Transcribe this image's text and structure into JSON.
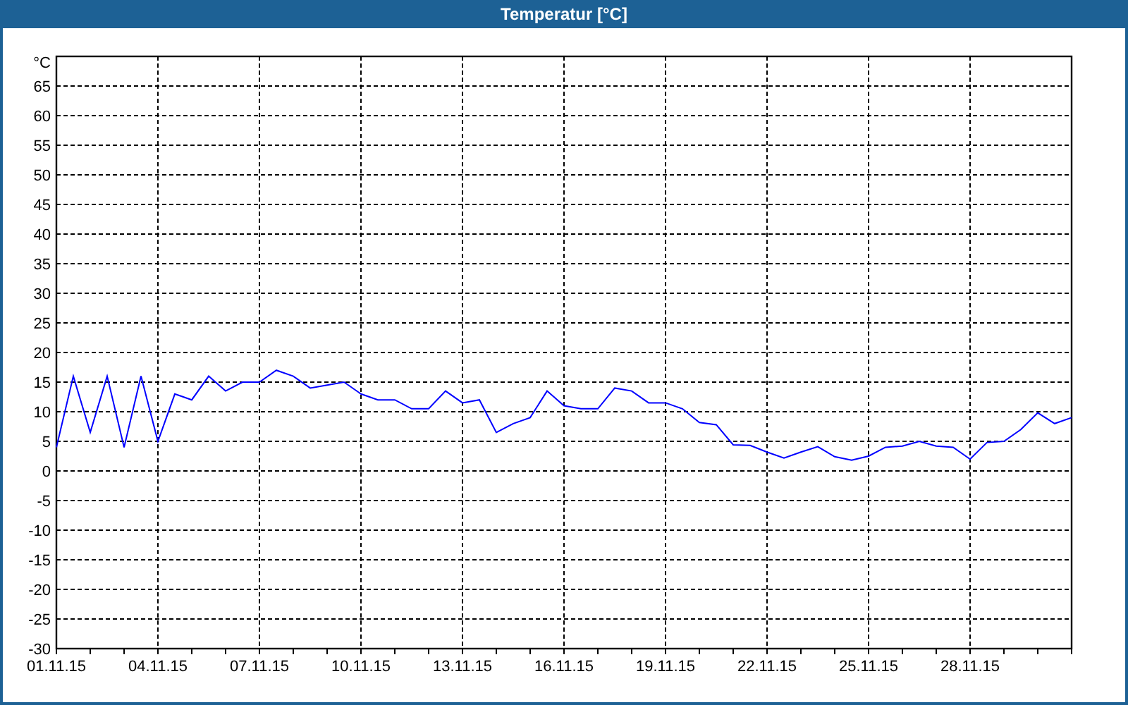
{
  "window": {
    "title": "Temperatur [°C]"
  },
  "chart": {
    "chart_data": {
      "type": "line",
      "grid": true,
      "ylabel": "°C",
      "ylim": [
        -30,
        70
      ],
      "yticks": [
        -30,
        -25,
        -20,
        -15,
        -10,
        -5,
        0,
        5,
        10,
        15,
        20,
        25,
        30,
        35,
        40,
        45,
        50,
        55,
        60,
        65
      ],
      "categories": [
        "01.11.15",
        null,
        null,
        null,
        null,
        null,
        "04.11.15",
        null,
        null,
        null,
        null,
        null,
        "07.11.15",
        null,
        null,
        null,
        null,
        null,
        "10.11.15",
        null,
        null,
        null,
        null,
        null,
        "13.11.15",
        null,
        null,
        null,
        null,
        null,
        "16.11.15",
        null,
        null,
        null,
        null,
        null,
        "19.11.15",
        null,
        null,
        null,
        null,
        null,
        "22.11.15",
        null,
        null,
        null,
        null,
        null,
        "25.11.15",
        null,
        null,
        null,
        null,
        null,
        "28.11.15",
        null,
        null,
        null,
        null,
        null,
        null
      ],
      "series": [
        {
          "color": "#0000ff",
          "values": [
            4,
            16,
            6.5,
            16,
            4,
            16,
            5,
            13,
            12,
            16,
            13.5,
            15,
            15,
            17,
            16,
            14,
            14.5,
            15,
            13,
            12,
            12,
            10.5,
            10.5,
            13.5,
            11.5,
            12,
            6.5,
            8,
            9,
            13.5,
            11,
            10.5,
            10.5,
            14,
            13.5,
            11.5,
            11.5,
            10.5,
            8.2,
            7.8,
            4.4,
            4.3,
            3.2,
            2.2,
            3.2,
            4.1,
            2.4,
            1.8,
            2.5,
            4,
            4.2,
            5,
            4.2,
            4,
            2,
            4.8,
            5,
            7,
            9.8,
            8,
            9
          ]
        }
      ]
    }
  }
}
